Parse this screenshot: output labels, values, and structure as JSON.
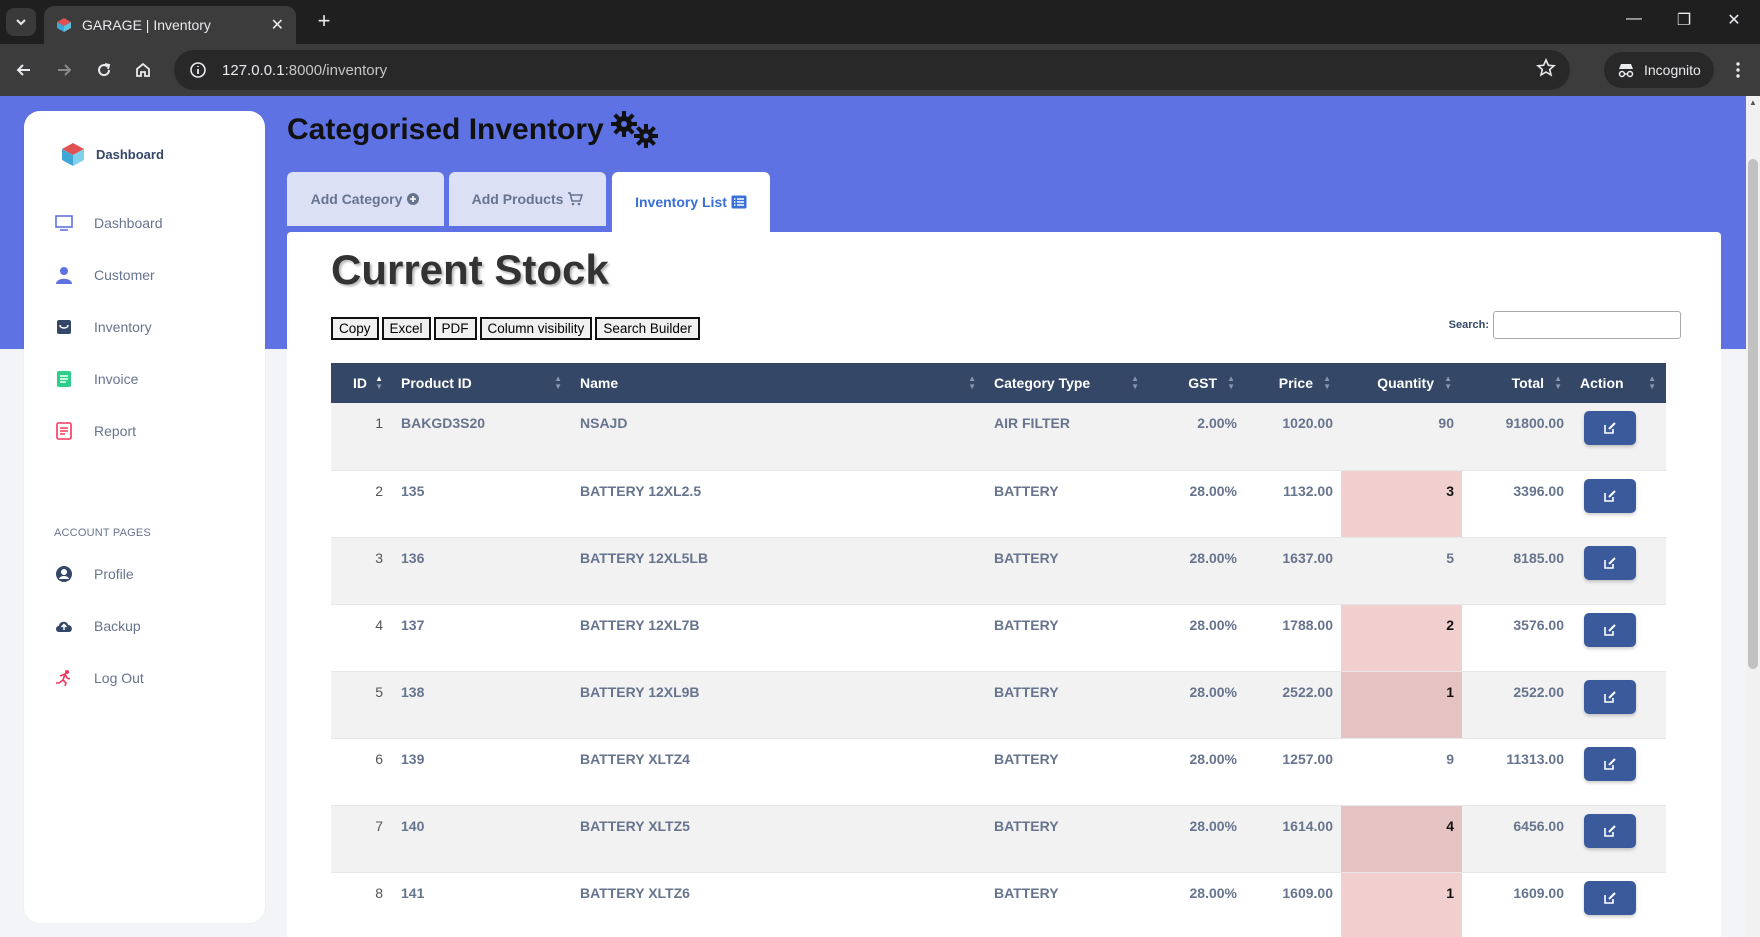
{
  "browser": {
    "tab_title": "GARAGE | Inventory",
    "url_host": "127.0.0.1",
    "url_rest": ":8000/inventory",
    "incognito_label": "Incognito"
  },
  "sidebar": {
    "brand": "Dashboard",
    "items": [
      {
        "label": "Dashboard",
        "icon": "monitor-icon"
      },
      {
        "label": "Customer",
        "icon": "user-icon"
      },
      {
        "label": "Inventory",
        "icon": "box-icon"
      },
      {
        "label": "Invoice",
        "icon": "invoice-icon"
      },
      {
        "label": "Report",
        "icon": "report-icon"
      }
    ],
    "section_label": "ACCOUNT PAGES",
    "account_items": [
      {
        "label": "Profile",
        "icon": "profile-icon"
      },
      {
        "label": "Backup",
        "icon": "cloud-upload-icon"
      },
      {
        "label": "Log Out",
        "icon": "running-icon"
      }
    ]
  },
  "page": {
    "title": "Categorised Inventory",
    "tabs": [
      {
        "label": "Add Category"
      },
      {
        "label": "Add Products"
      },
      {
        "label": "Inventory List"
      }
    ]
  },
  "card": {
    "title": "Current Stock",
    "buttons": [
      "Copy",
      "Excel",
      "PDF",
      "Column visibility",
      "Search Builder"
    ],
    "search_label": "Search:",
    "search_value": ""
  },
  "table": {
    "headers": [
      "ID",
      "Product ID",
      "Name",
      "Category Type",
      "GST",
      "Price",
      "Quantity",
      "Total",
      "Action"
    ],
    "rows": [
      {
        "id": "1",
        "product_id": "BAKGD3S20",
        "name": "NSAJD",
        "category": "AIR FILTER",
        "gst": "2.00%",
        "price": "1020.00",
        "quantity": "90",
        "total": "91800.00",
        "low": false
      },
      {
        "id": "2",
        "product_id": "135",
        "name": "BATTERY 12XL2.5",
        "category": "BATTERY",
        "gst": "28.00%",
        "price": "1132.00",
        "quantity": "3",
        "total": "3396.00",
        "low": true
      },
      {
        "id": "3",
        "product_id": "136",
        "name": "BATTERY 12XL5LB",
        "category": "BATTERY",
        "gst": "28.00%",
        "price": "1637.00",
        "quantity": "5",
        "total": "8185.00",
        "low": false
      },
      {
        "id": "4",
        "product_id": "137",
        "name": "BATTERY 12XL7B",
        "category": "BATTERY",
        "gst": "28.00%",
        "price": "1788.00",
        "quantity": "2",
        "total": "3576.00",
        "low": true
      },
      {
        "id": "5",
        "product_id": "138",
        "name": "BATTERY 12XL9B",
        "category": "BATTERY",
        "gst": "28.00%",
        "price": "2522.00",
        "quantity": "1",
        "total": "2522.00",
        "low": true
      },
      {
        "id": "6",
        "product_id": "139",
        "name": "BATTERY XLTZ4",
        "category": "BATTERY",
        "gst": "28.00%",
        "price": "1257.00",
        "quantity": "9",
        "total": "11313.00",
        "low": false
      },
      {
        "id": "7",
        "product_id": "140",
        "name": "BATTERY XLTZ5",
        "category": "BATTERY",
        "gst": "28.00%",
        "price": "1614.00",
        "quantity": "4",
        "total": "6456.00",
        "low": true
      },
      {
        "id": "8",
        "product_id": "141",
        "name": "BATTERY XLTZ6",
        "category": "BATTERY",
        "gst": "28.00%",
        "price": "1609.00",
        "quantity": "1",
        "total": "1609.00",
        "low": true
      }
    ]
  },
  "colors": {
    "hero": "#5e72e4",
    "table_header": "#344767",
    "edit_button": "#3a5a9c",
    "low_stock": "#f2cfcf"
  }
}
